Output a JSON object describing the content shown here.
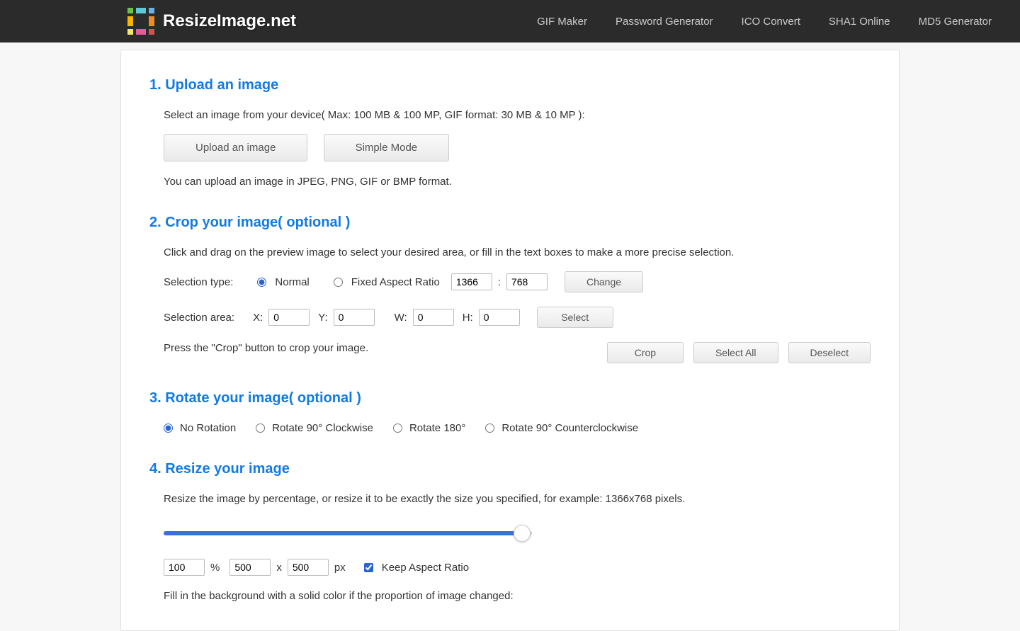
{
  "header": {
    "brand": "ResizeImage.net",
    "nav": {
      "gif": "GIF Maker",
      "pwd": "Password Generator",
      "ico": "ICO Convert",
      "sha1": "SHA1 Online",
      "md5": "MD5 Generator"
    }
  },
  "s1": {
    "title": "1. Upload an image",
    "instruction": "Select an image from your device( Max: 100 MB & 100 MP, GIF format: 30 MB & 10 MP ):",
    "btn_upload": "Upload an image",
    "btn_simple": "Simple Mode",
    "note": "You can upload an image in JPEG, PNG, GIF or BMP format."
  },
  "s2": {
    "title": "2. Crop your image( optional )",
    "instruction": "Click and drag on the preview image to select your desired area, or fill in the text boxes to make a more precise selection.",
    "label_type": "Selection type:",
    "radio_normal": "Normal",
    "radio_fixed": "Fixed Aspect Ratio",
    "ratio_w": "1366",
    "ratio_sep": ":",
    "ratio_h": "768",
    "btn_change": "Change",
    "label_area": "Selection area:",
    "lbl_x": "X:",
    "val_x": "0",
    "lbl_y": "Y:",
    "val_y": "0",
    "lbl_w": "W:",
    "val_w": "0",
    "lbl_h": "H:",
    "val_h": "0",
    "btn_select": "Select",
    "note": "Press the \"Crop\" button to crop your image.",
    "btn_crop": "Crop",
    "btn_selectall": "Select All",
    "btn_deselect": "Deselect"
  },
  "s3": {
    "title": "3. Rotate your image( optional )",
    "r0": "No Rotation",
    "r90cw": "Rotate 90° Clockwise",
    "r180": "Rotate 180°",
    "r90ccw": "Rotate 90° Counterclockwise"
  },
  "s4": {
    "title": "4. Resize your image",
    "instruction": "Resize the image by percentage, or resize it to be exactly the size you specified, for example: 1366x768 pixels.",
    "pct": "100",
    "pct_unit": "%",
    "w": "500",
    "x_sep": "x",
    "h": "500",
    "px_unit": "px",
    "keep_ratio": "Keep Aspect Ratio",
    "bg_note": "Fill in the background with a solid color if the proportion of image changed:"
  }
}
